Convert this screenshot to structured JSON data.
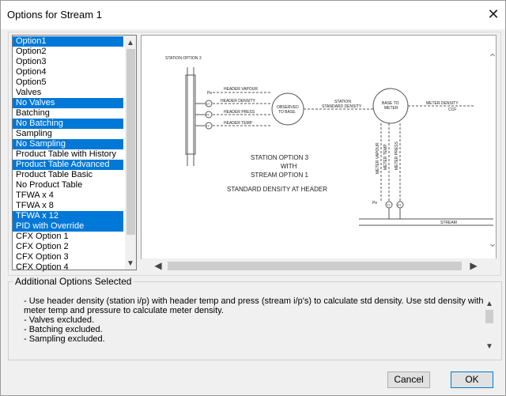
{
  "window": {
    "title": "Options for Stream 1",
    "close_glyph": "✕"
  },
  "options_list": {
    "items": [
      {
        "label": "Option1",
        "selected": true
      },
      {
        "label": "Option2",
        "selected": false
      },
      {
        "label": "Option3",
        "selected": false
      },
      {
        "label": "Option4",
        "selected": false
      },
      {
        "label": "Option5",
        "selected": false
      },
      {
        "label": "Valves",
        "selected": false
      },
      {
        "label": "No Valves",
        "selected": true
      },
      {
        "label": "Batching",
        "selected": false
      },
      {
        "label": "No Batching",
        "selected": true
      },
      {
        "label": "Sampling",
        "selected": false
      },
      {
        "label": "No Sampling",
        "selected": true
      },
      {
        "label": "Product Table with History",
        "selected": false
      },
      {
        "label": "Product Table Advanced",
        "selected": true
      },
      {
        "label": "Product Table Basic",
        "selected": false
      },
      {
        "label": "No Product Table",
        "selected": false
      },
      {
        "label": "TFWA x 4",
        "selected": false
      },
      {
        "label": "TFWA x 8",
        "selected": false
      },
      {
        "label": "TFWA x 12",
        "selected": true
      },
      {
        "label": "PID with Override",
        "selected": true
      },
      {
        "label": "CFX Option 1",
        "selected": false
      },
      {
        "label": "CFX Option 2",
        "selected": false
      },
      {
        "label": "CFX Option 3",
        "selected": false
      },
      {
        "label": "CFX Option 4",
        "selected": false
      }
    ]
  },
  "diagram": {
    "station_label": "STATION OPTION 3",
    "pe_label": "Pe",
    "pe_label_2": "Pe",
    "header_vapour": "HEADER VAPOUR",
    "header_density": "HEADER DENSITY",
    "header_press": "HEADER PRESS",
    "header_temp": "HEADER TEMP",
    "dt": "DT",
    "pt": "PT",
    "tt": "TT",
    "observed_1": "OBSERVED",
    "observed_2": "TO BASE",
    "station_std_1": "STATION",
    "station_std_2": "STANDARD DENSITY",
    "base_meter_1": "BASE TO",
    "base_meter_2": "METER",
    "meter_density": "METER DENSITY",
    "ccf": "CCF",
    "meter_vapour": "METER VAPOUR",
    "meter_temp": "METER TEMP",
    "meter_press": "METER PRESS",
    "tt2": "TT",
    "pt2": "PT",
    "stream": "STREAM",
    "center_1": "STATION OPTION 3",
    "center_2": "WITH",
    "center_3": "STREAM OPTION 1",
    "center_4": "STANDARD DENSITY AT HEADER"
  },
  "additional_options": {
    "label": "Additional Options Selected",
    "lines": [
      "- Use header density (station i/p) with header temp and press (stream i/p's) to calculate std density. Use std density with",
      "meter temp and pressure to calculate meter density.",
      "- Valves excluded.",
      "- Batching excluded.",
      "- Sampling excluded."
    ]
  },
  "buttons": {
    "cancel": "Cancel",
    "ok": "OK"
  },
  "colors": {
    "selection": "#0078d7",
    "dialog_bg": "#f0f0f0"
  }
}
